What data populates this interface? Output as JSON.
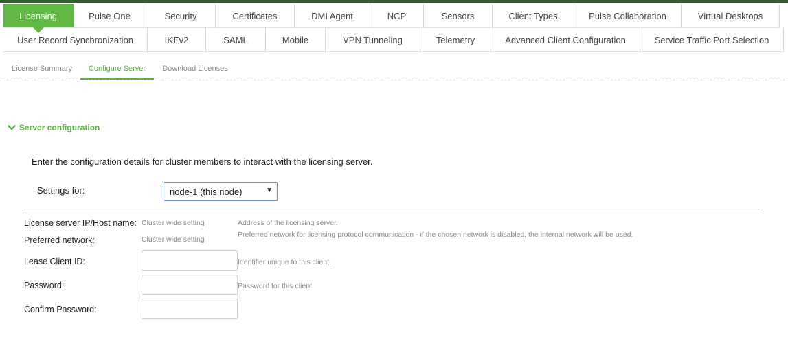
{
  "tabs_row1": [
    {
      "label": "Licensing",
      "active": true
    },
    {
      "label": "Pulse One"
    },
    {
      "label": "Security"
    },
    {
      "label": "Certificates"
    },
    {
      "label": "DMI Agent"
    },
    {
      "label": "NCP"
    },
    {
      "label": "Sensors"
    },
    {
      "label": "Client Types"
    },
    {
      "label": "Pulse Collaboration"
    },
    {
      "label": "Virtual Desktops"
    }
  ],
  "tabs_row2": [
    {
      "label": "User Record Synchronization"
    },
    {
      "label": "IKEv2"
    },
    {
      "label": "SAML"
    },
    {
      "label": "Mobile"
    },
    {
      "label": "VPN Tunneling"
    },
    {
      "label": "Telemetry"
    },
    {
      "label": "Advanced Client Configuration"
    },
    {
      "label": "Service Traffic Port Selection"
    }
  ],
  "subtabs": [
    {
      "label": "License Summary"
    },
    {
      "label": "Configure Server",
      "active": true
    },
    {
      "label": "Download Licenses"
    }
  ],
  "section": {
    "title": "Server configuration",
    "icon": "chevron-down-icon"
  },
  "intro": "Enter the configuration details for cluster members to interact with the licensing server.",
  "settings_for": {
    "label": "Settings for:",
    "selected": "node-1 (this node)"
  },
  "fields": {
    "server_ip": {
      "label": "License server IP/Host name:",
      "value": "Cluster wide setting",
      "help": "Address of the licensing server."
    },
    "preferred_network": {
      "label": "Preferred network:",
      "value": "Cluster wide setting",
      "help": "Preferred network for licensing protocol communication - if the chosen network is disabled, the internal network will be used."
    },
    "lease_client_id": {
      "label": "Lease Client ID:",
      "value": "",
      "help": "Identifier unique to this client."
    },
    "password": {
      "label": "Password:",
      "value": "",
      "help": "Password for this client."
    },
    "confirm_password": {
      "label": "Confirm Password:",
      "value": ""
    }
  },
  "colors": {
    "accent": "#5fb944",
    "top_bar": "#2f5d2c"
  }
}
